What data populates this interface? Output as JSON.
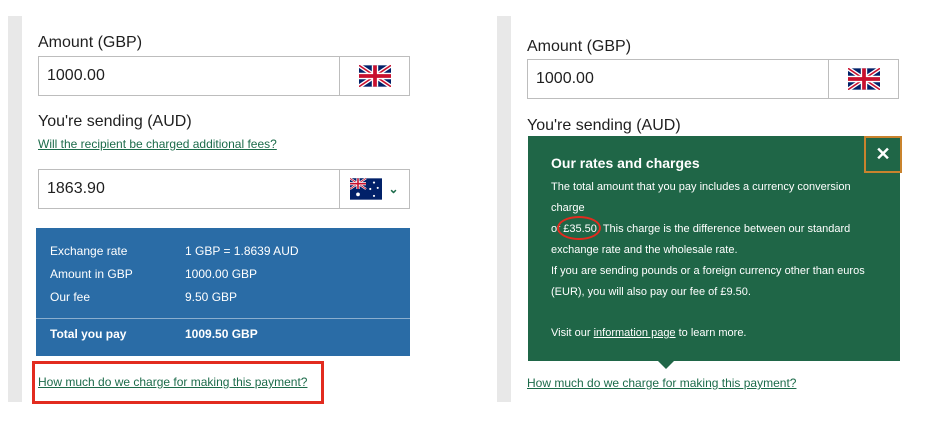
{
  "left": {
    "amount_label": "Amount (GBP)",
    "amount_value": "1000.00",
    "sending_label": "You're sending (AUD)",
    "recipient_fees_link": "Will the recipient be charged additional fees?",
    "sending_value": "1863.90",
    "summary": {
      "rows": [
        {
          "label": "Exchange rate",
          "value": "1 GBP = 1.8639 AUD"
        },
        {
          "label": "Amount in GBP",
          "value": "1000.00 GBP"
        },
        {
          "label": "Our fee",
          "value": "9.50 GBP"
        }
      ],
      "total_label": "Total you pay",
      "total_value": "1009.50 GBP"
    },
    "charge_link": "How much do we charge for making this payment?"
  },
  "right": {
    "amount_label": "Amount (GBP)",
    "amount_value": "1000.00",
    "sending_label": "You're sending (AUD)",
    "popup": {
      "title": "Our rates and charges",
      "para1_a": "The total amount that you pay includes a currency conversion charge",
      "para1_b": "of",
      "para1_amount": "£35.50",
      "para1_c": ". This charge is the difference between our standard",
      "para1_d": "exchange rate and the wholesale rate.",
      "para2_a": "If you are sending pounds or a foreign currency other than euros",
      "para2_b": "(EUR), you will also pay our fee of £9.50.",
      "para3_a": "Visit our",
      "para3_link": "information page",
      "para3_b": "to learn more.",
      "close_glyph": "✕"
    },
    "charge_link": "How much do we charge for making this payment?"
  },
  "icons": {
    "uk_flag": "uk-flag-icon",
    "au_flag": "australia-flag-icon",
    "chevron": "chevron-down-icon",
    "close": "close-icon"
  },
  "colors": {
    "summary_blue": "#2a6ca6",
    "popup_green": "#1f6647",
    "link_green": "#1c6b4a",
    "highlight_red": "#e22b1f",
    "close_border": "#c9832d"
  }
}
